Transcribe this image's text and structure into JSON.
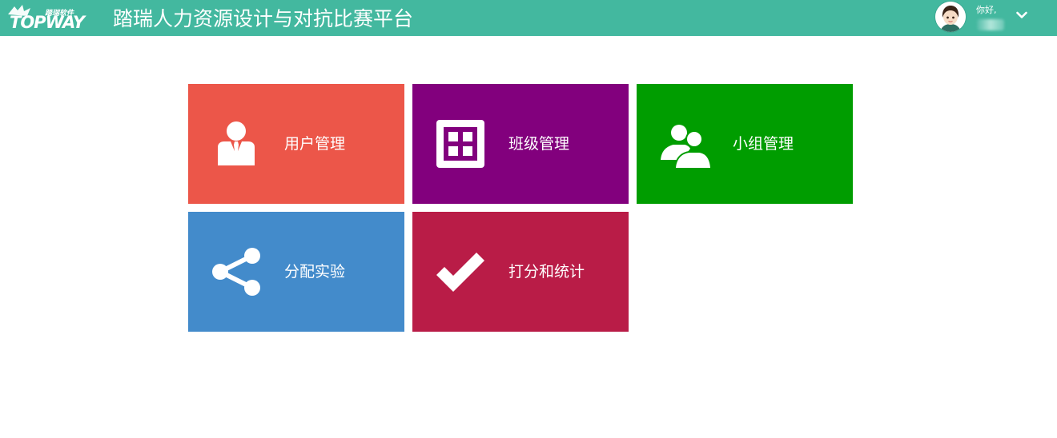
{
  "header": {
    "logo_sub": "踏瑞软件",
    "logo_main": "TOPWAY",
    "title": "踏瑞人力资源设计与对抗比赛平台",
    "greeting": "你好,",
    "user_menu_icon": "chevron-down-icon",
    "colors": {
      "bar": "#43b89f",
      "text": "#ffffff"
    }
  },
  "tiles": [
    {
      "label": "用户管理",
      "icon": "user-suit-icon",
      "color": "#ec5649"
    },
    {
      "label": "班级管理",
      "icon": "grid-icon",
      "color": "#82007d"
    },
    {
      "label": "小组管理",
      "icon": "users-icon",
      "color": "#009d00"
    },
    {
      "label": "分配实验",
      "icon": "share-icon",
      "color": "#438bcb"
    },
    {
      "label": "打分和统计",
      "icon": "checkmark-icon",
      "color": "#b91c47"
    }
  ]
}
